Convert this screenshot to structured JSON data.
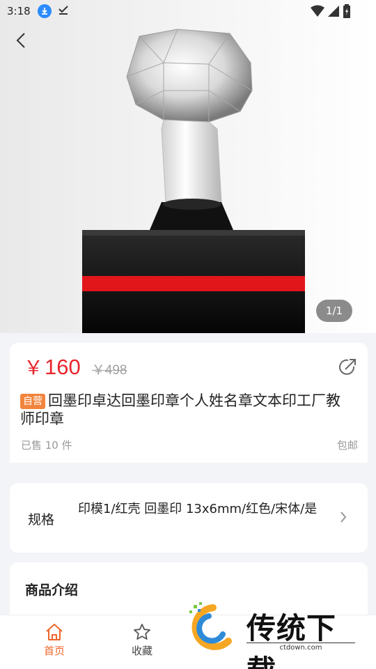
{
  "status_bar": {
    "time": "3:18"
  },
  "product": {
    "image_counter": "1/1",
    "price_symbol": "￥",
    "price": "160",
    "original_price": "￥498",
    "tag": "自营",
    "title": "回墨印卓达回墨印章个人姓名章文本印工厂教师印章",
    "sold": "已售 10 件",
    "shipping": "包邮"
  },
  "spec": {
    "label": "规格",
    "value": "印模1/红壳 回墨印 13x6mm/红色/宋体/是"
  },
  "intro": {
    "title": "商品介绍"
  },
  "nav": {
    "home": "首页",
    "favorites": "收藏"
  },
  "watermark": {
    "text": "传统下载",
    "site": "ctdown.com"
  },
  "colors": {
    "price_red": "#e8262d",
    "tag_orange": "#f2853e",
    "nav_active": "#f0662b"
  }
}
